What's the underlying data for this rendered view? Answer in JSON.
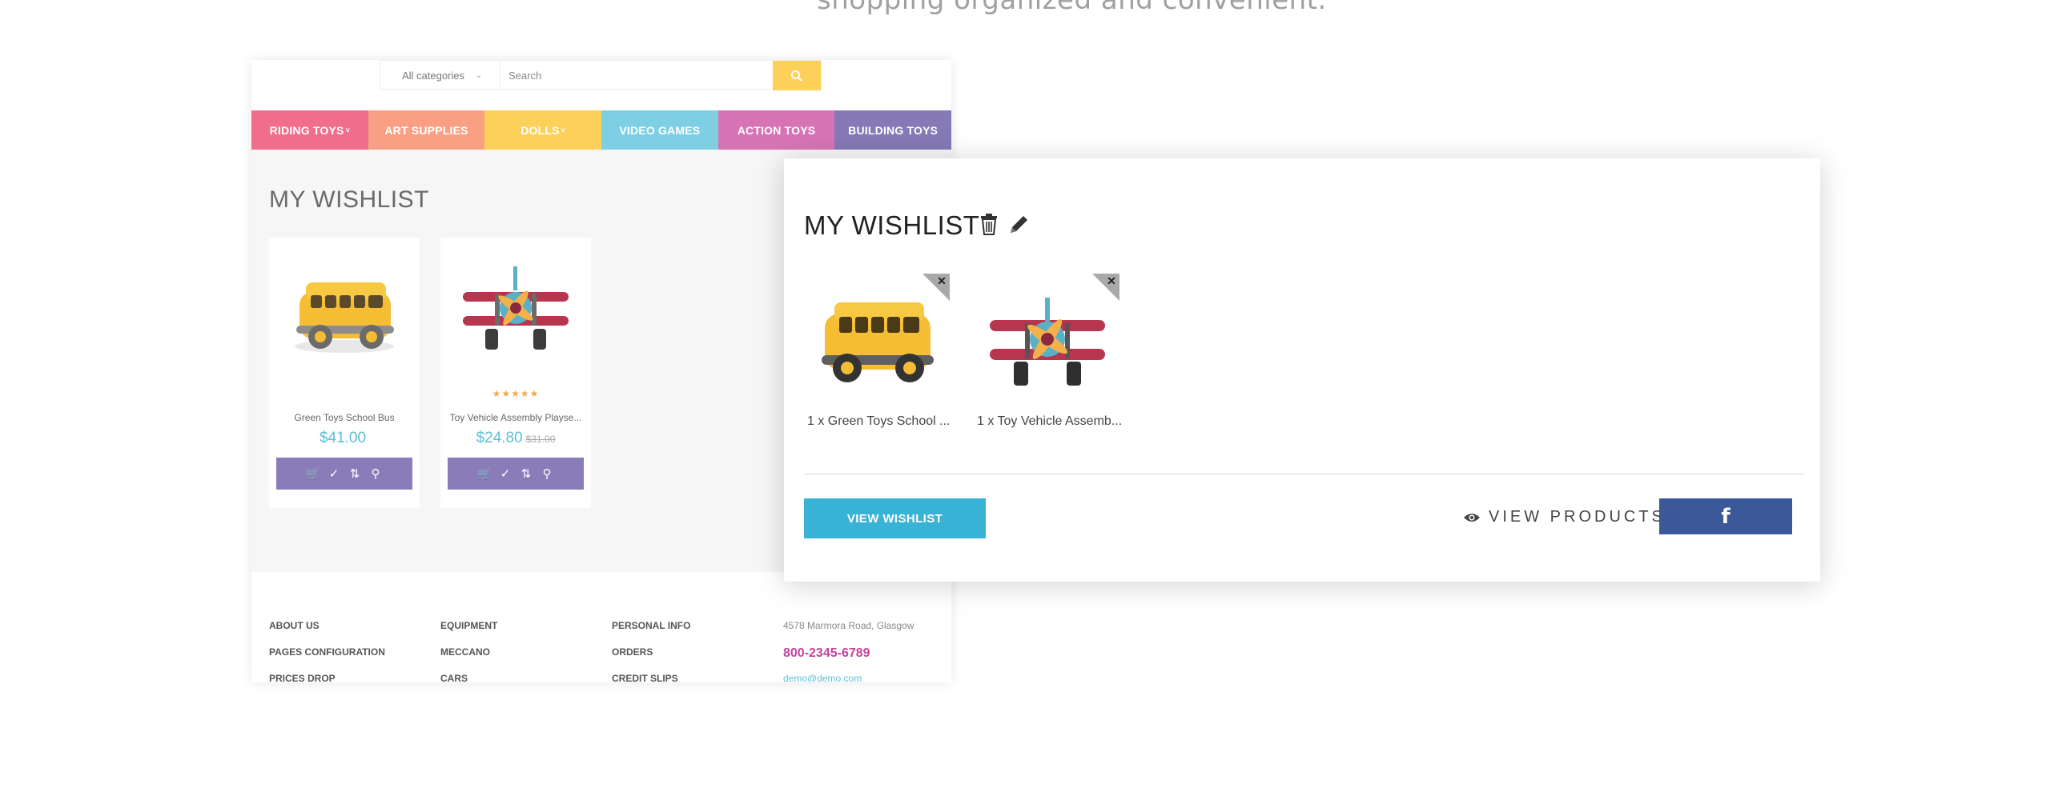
{
  "header_text": "shopping organized and convenient.",
  "store": {
    "search": {
      "category_label": "All categories",
      "placeholder": "Search"
    },
    "categories": [
      {
        "label": "RIDING TOYS",
        "color": "#f06e8b"
      },
      {
        "label": "ART SUPPLIES",
        "color": "#f9a084"
      },
      {
        "label": "DOLLS",
        "color": "#fdd05a"
      },
      {
        "label": "VIDEO GAMES",
        "color": "#7fcfe4"
      },
      {
        "label": "ACTION TOYS",
        "color": "#d774b6"
      },
      {
        "label": "BUILDING TOYS",
        "color": "#8579b6"
      }
    ],
    "wishlist_title": "MY WISHLIST",
    "products": [
      {
        "name": "Green Toys School Bus",
        "price": "$41.00",
        "old_price": "",
        "stars": ""
      },
      {
        "name": "Toy Vehicle Assembly Playse...",
        "price": "$24.80",
        "old_price": "$31.00",
        "stars": "★★★★★"
      }
    ],
    "footer": {
      "col1": [
        "ABOUT US",
        "PAGES CONFIGURATION",
        "PRICES DROP"
      ],
      "col2": [
        "EQUIPMENT",
        "MECCANO",
        "CARS"
      ],
      "col3": [
        "PERSONAL INFO",
        "ORDERS",
        "CREDIT SLIPS"
      ],
      "address": "4578 Marmora Road, Glasgow",
      "phone": "800-2345-6789",
      "email": "demo@demo.com"
    }
  },
  "popup": {
    "title": "MY WISHLIST",
    "items": [
      {
        "label": "1 x Green Toys School ..."
      },
      {
        "label": "1 x Toy Vehicle Assemb..."
      }
    ],
    "view_wishlist": "VIEW WISHLIST",
    "view_products": "VIEW PRODUCTS",
    "facebook_icon": "f"
  }
}
